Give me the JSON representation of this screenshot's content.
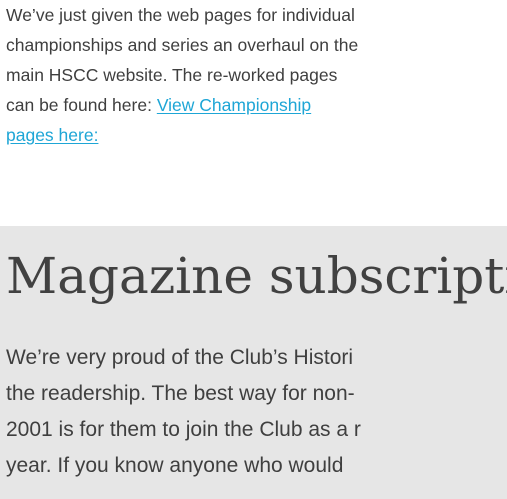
{
  "intro": {
    "line1": "We’ve just given the web pages for individual",
    "line2": "championships and series an overhaul on the",
    "line3": "main HSCC website. The re-worked pages",
    "line4_prefix": "can be found here: ",
    "link_part1": "View Championship",
    "link_part2": "pages here:"
  },
  "magazine": {
    "title": "Magazine subscripti",
    "line1": "We’re very proud of the Club’s Histori",
    "line2": "the readership. The best way for non-",
    "line3": "2001 is for them to join the Club as a r",
    "line4": "year. If you know anyone who would"
  },
  "colors": {
    "link": "#1ea6d6",
    "band_background": "#e6e6e6",
    "text": "#3f3f3f"
  }
}
